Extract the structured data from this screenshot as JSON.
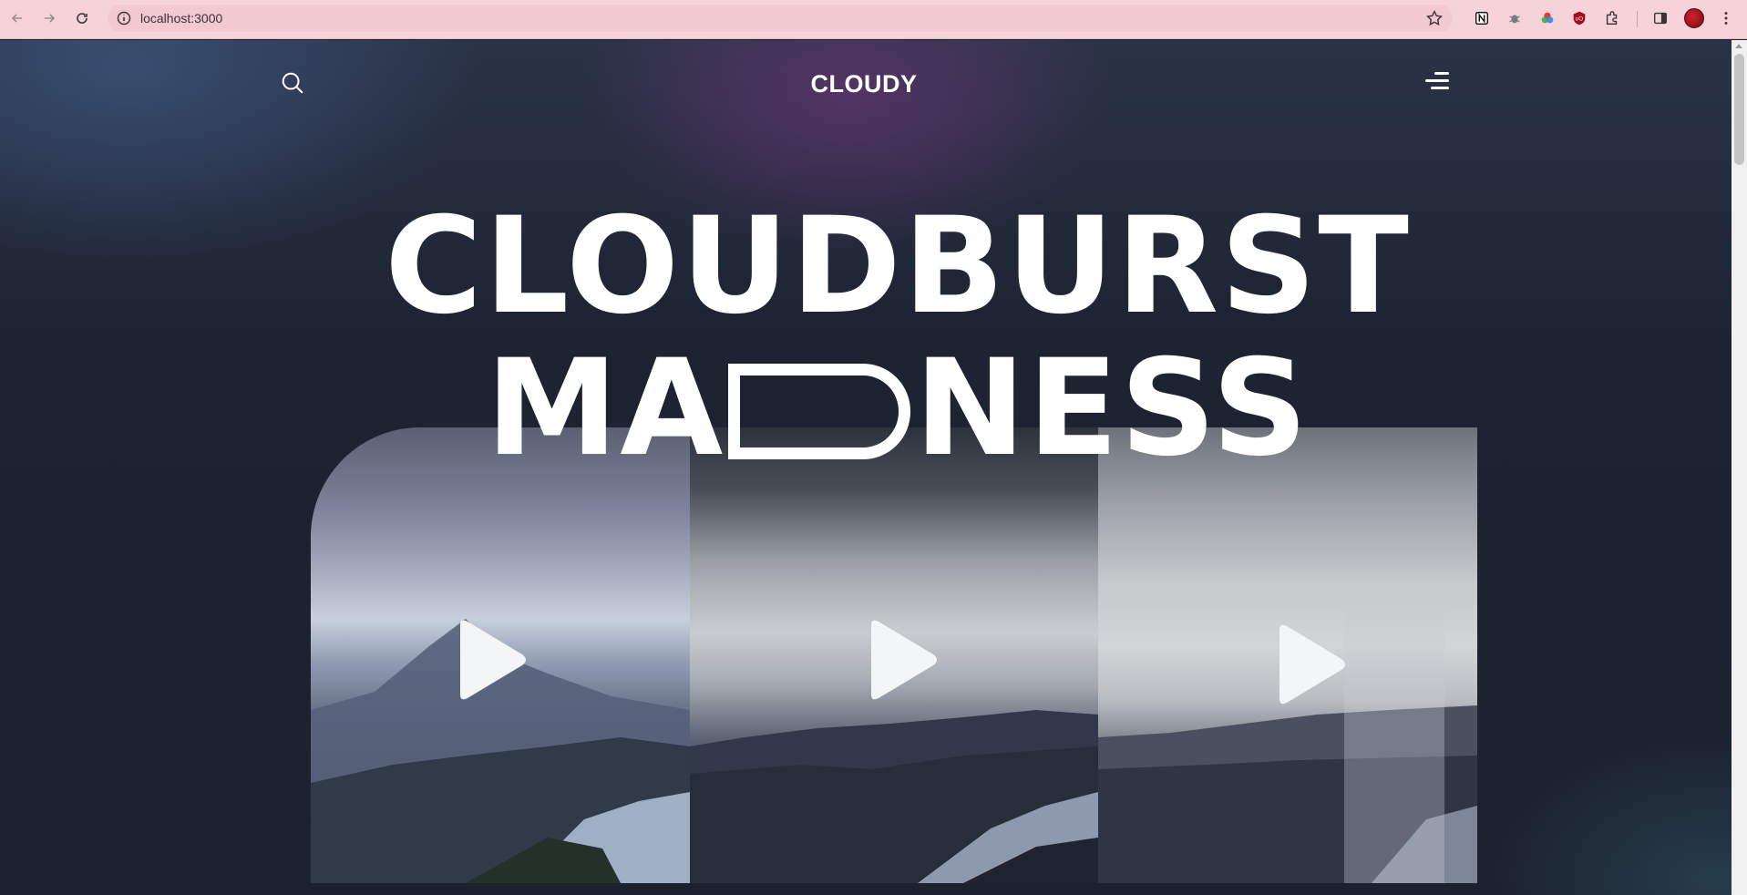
{
  "browser": {
    "url": "localhost:3000"
  },
  "site": {
    "brand": "CLOUDY",
    "hero": {
      "line1": "CLOUDBURST",
      "line2_left": "MA",
      "line2_right": "NESS"
    },
    "videos": [
      {
        "icon": "play-icon"
      },
      {
        "icon": "play-icon"
      },
      {
        "icon": "play-icon"
      }
    ]
  },
  "colors": {
    "chrome_bg": "#f5d3d9",
    "page_bg": "#1c222e",
    "text": "#ffffff"
  }
}
